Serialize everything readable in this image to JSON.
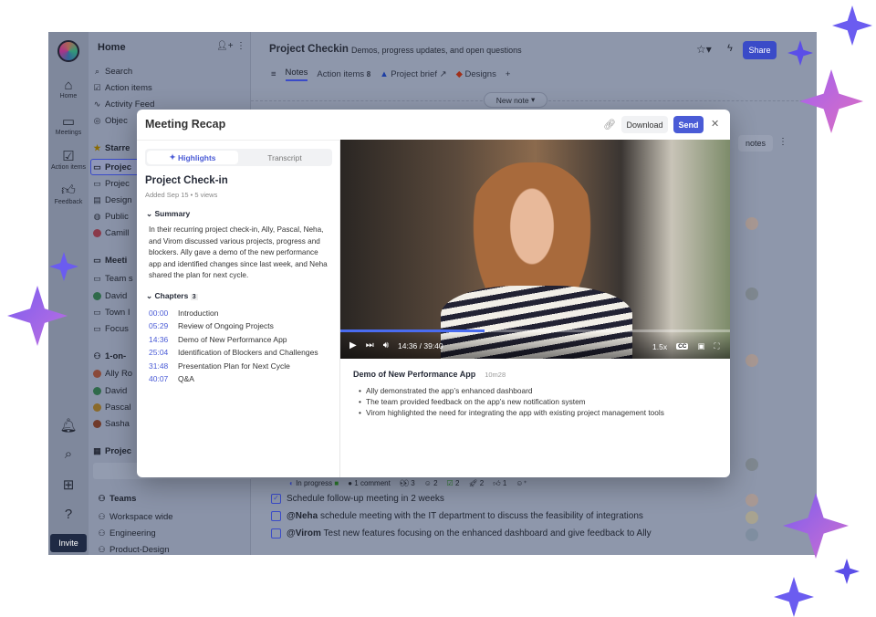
{
  "rail": {
    "logo": "ACME",
    "items": [
      {
        "label": "Home",
        "icon": "home-icon"
      },
      {
        "label": "Meetings",
        "icon": "calendar-icon"
      },
      {
        "label": "Action items",
        "icon": "checkbox-icon"
      },
      {
        "label": "Feedback",
        "icon": "thumbs-up-icon"
      }
    ],
    "invite": "Invite"
  },
  "sidebar": {
    "title": "Home",
    "nav": [
      "Search",
      "Action items",
      "Activity Feed",
      "Objec"
    ],
    "starred": {
      "label": "Starre",
      "items": [
        "Projec",
        "Projec",
        "Design",
        "Public",
        "Camill"
      ]
    },
    "meetings": {
      "label": "Meeti",
      "items": [
        "Team s",
        "David",
        "Town I",
        "Focus"
      ]
    },
    "one_on_one": {
      "label": "1-on-",
      "items": [
        "Ally Ro",
        "David",
        "Pascal",
        "Sasha"
      ]
    },
    "projects": {
      "label": "Projec"
    },
    "teams": {
      "label": "Teams",
      "items": [
        "Workspace wide",
        "Engineering",
        "Product-Design"
      ]
    }
  },
  "main": {
    "title": "Project Checkin",
    "subtitle": "Demos, progress updates, and open questions",
    "share": "Share",
    "tabs": [
      {
        "label": "Notes",
        "active": true
      },
      {
        "label": "Action items",
        "count": "8"
      },
      {
        "label": "Project brief"
      },
      {
        "label": "Designs"
      }
    ],
    "new_note": "New note",
    "notes_btn": "notes",
    "status_row": {
      "status": "In progress",
      "comments": "1 comment",
      "reactions": [
        "3",
        "2",
        "2",
        "2",
        "1"
      ]
    },
    "todos": [
      {
        "checked": true,
        "mention": "",
        "text": "Schedule follow-up meeting in 2 weeks"
      },
      {
        "checked": false,
        "mention": "@Neha",
        "text": " schedule meeting with the IT department to discuss the feasibility of integrations"
      },
      {
        "checked": false,
        "mention": "@Virom",
        "text": " Test new features focusing on the enhanced dashboard and give feedback to Ally"
      }
    ]
  },
  "modal": {
    "title": "Meeting Recap",
    "download": "Download",
    "send": "Send",
    "tabs": [
      "Highlights",
      "Transcript"
    ],
    "meeting_title": "Project Check-in",
    "meta": "Added Sep 15 • 5 views",
    "summary_label": "Summary",
    "summary": "In their recurring project check-in, Ally, Pascal, Neha, and Virom discussed various projects, progress and blockers. Ally gave a demo of the new performance app and identified changes since last week, and Neha shared the plan for next cycle.",
    "chapters_label": "Chapters",
    "chapters_count": "3",
    "chapters": [
      {
        "time": "00:00",
        "title": "Introduction"
      },
      {
        "time": "05:29",
        "title": "Review of Ongoing Projects"
      },
      {
        "time": "14:36",
        "title": "Demo of New Performance App"
      },
      {
        "time": "25:04",
        "title": "Identification of Blockers and Challenges"
      },
      {
        "time": "31:48",
        "title": "Presentation Plan for Next Cycle"
      },
      {
        "time": "40:07",
        "title": "Q&A"
      }
    ],
    "video": {
      "time": "14:36 / 39:40",
      "speed": "1.5x",
      "cc": "CC",
      "progress": 0.37
    },
    "chapter_detail": {
      "title": "Demo of New Performance App",
      "duration": "10m28",
      "bullets": [
        "Ally demonstrated the app’s enhanced dashboard",
        "The team provided feedback on the app’s new notification system",
        "Virom highlighted the need for integrating the app with existing project management tools"
      ]
    }
  },
  "colors": {
    "accent": "#4a5bd6",
    "sparkle": "#7c5cf5"
  }
}
